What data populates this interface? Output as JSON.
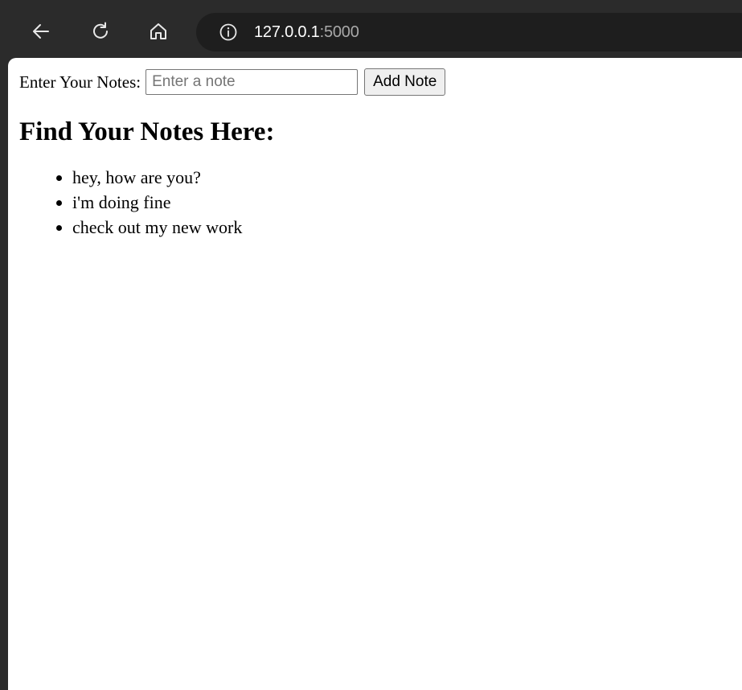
{
  "browser": {
    "url_host": "127.0.0.1",
    "url_port": ":5000",
    "icons": {
      "back": "back-arrow-icon",
      "reload": "reload-icon",
      "home": "home-icon",
      "info": "info-icon"
    }
  },
  "form": {
    "label": "Enter Your Notes:",
    "input_placeholder": "Enter a note",
    "input_value": "",
    "button_label": "Add Note"
  },
  "heading": "Find Your Notes Here:",
  "notes": [
    "hey, how are you?",
    "i'm doing fine",
    "check out my new work"
  ],
  "colors": {
    "chrome_bg": "#2b2b2b",
    "address_bar_bg": "#1e1e1e",
    "page_bg": "#ffffff"
  }
}
